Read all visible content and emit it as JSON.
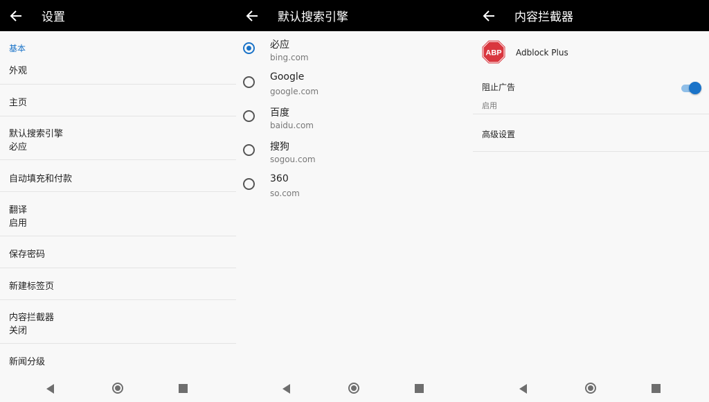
{
  "settings": {
    "title": "设置",
    "section": "基本",
    "items": [
      {
        "title": "外观",
        "sub": ""
      },
      {
        "title": "主页",
        "sub": ""
      },
      {
        "title": "默认搜索引擎",
        "sub": "必应"
      },
      {
        "title": "自动填充和付款",
        "sub": ""
      },
      {
        "title": "翻译",
        "sub": "启用"
      },
      {
        "title": "保存密码",
        "sub": ""
      },
      {
        "title": "新建标签页",
        "sub": ""
      },
      {
        "title": "内容拦截器",
        "sub": "关闭"
      },
      {
        "title": "新闻分级",
        "sub": ""
      }
    ]
  },
  "search_engine": {
    "title": "默认搜索引擎",
    "selected_index": 0,
    "engines": [
      {
        "name": "必应",
        "url": "bing.com"
      },
      {
        "name": "Google",
        "url": "google.com"
      },
      {
        "name": "百度",
        "url": "baidu.com"
      },
      {
        "name": "搜狗",
        "url": "sogou.com"
      },
      {
        "name": "360",
        "url": "so.com"
      }
    ]
  },
  "content_blocker": {
    "title": "内容拦截器",
    "logo_text": "ABP",
    "name": "Adblock Plus",
    "block_ads_label": "阻止广告",
    "block_ads_status": "启用",
    "block_ads_on": true,
    "advanced_label": "高级设置"
  },
  "colors": {
    "accent": "#1a73c8",
    "appbar": "#000000",
    "abp_red": "#d9363e"
  }
}
